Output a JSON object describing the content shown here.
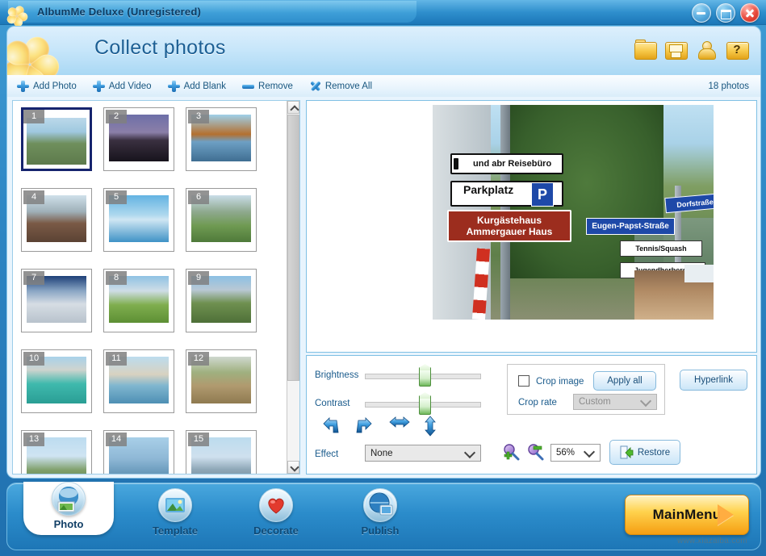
{
  "window": {
    "title": "AlbumMe Deluxe (Unregistered)",
    "app_icon": "flower-logo-icon",
    "controls": [
      {
        "name": "minimize-button",
        "icon": "minimize-icon"
      },
      {
        "name": "maximize-button",
        "icon": "maximize-icon"
      },
      {
        "name": "close-button",
        "icon": "close-icon"
      }
    ]
  },
  "header": {
    "logo_icon": "flower-logo-icon",
    "page_title": "Collect photos",
    "icons": [
      {
        "name": "open-project-icon",
        "label": "Open"
      },
      {
        "name": "save-project-icon",
        "label": "Save"
      },
      {
        "name": "user-account-icon",
        "label": "Account"
      },
      {
        "name": "help-icon",
        "label": "Help",
        "glyph": "?"
      }
    ]
  },
  "toolbar": {
    "buttons": [
      {
        "label": "Add Photo",
        "icon": "add-plus-icon"
      },
      {
        "label": "Add Video",
        "icon": "add-plus-icon"
      },
      {
        "label": "Add Blank",
        "icon": "add-plus-icon"
      },
      {
        "label": "Remove",
        "icon": "minus-bar-icon"
      },
      {
        "label": "Remove All",
        "icon": "cross-x-icon"
      }
    ],
    "photo_count": "18 photos"
  },
  "thumbnails": {
    "selected_index": 1,
    "items": [
      {
        "num": "1",
        "alt": "street direction signs"
      },
      {
        "num": "2",
        "alt": "matterhorn at dusk"
      },
      {
        "num": "3",
        "alt": "autumn lake reflection"
      },
      {
        "num": "4",
        "alt": "alpine village street"
      },
      {
        "num": "5",
        "alt": "matterhorn lake reflection"
      },
      {
        "num": "6",
        "alt": "green valley cliffs"
      },
      {
        "num": "7",
        "alt": "snow glacier"
      },
      {
        "num": "8",
        "alt": "meadow and snowy peaks"
      },
      {
        "num": "9",
        "alt": "red train in valley"
      },
      {
        "num": "10",
        "alt": "castle on turquoise lake"
      },
      {
        "num": "11",
        "alt": "chillon castle lake"
      },
      {
        "num": "12",
        "alt": "bench under tree"
      },
      {
        "num": "13",
        "alt": "lakeside trees"
      },
      {
        "num": "14",
        "alt": "boat on lake"
      },
      {
        "num": "15",
        "alt": "church spire by lake"
      }
    ],
    "scrollbar": {
      "up_arrow_icon": "chevron-up-icon",
      "down_arrow_icon": "chevron-down-icon"
    }
  },
  "preview": {
    "photo_alt": "German street direction signs",
    "signs": [
      "und abr Reisebüro",
      "Parkplatz",
      "Kurgästehaus",
      "Ammergauer Haus",
      "Eugen-Papst-Straße",
      "Dorfstraße",
      "Tennis/Squash",
      "Jugendherberge"
    ]
  },
  "edit": {
    "brightness_label": "Brightness",
    "contrast_label": "Contrast",
    "brightness_value": 50,
    "contrast_value": 50,
    "rotate_icons": [
      {
        "name": "rotate-left-icon"
      },
      {
        "name": "rotate-right-icon"
      },
      {
        "name": "flip-horizontal-icon"
      },
      {
        "name": "flip-vertical-icon"
      }
    ],
    "effect_label": "Effect",
    "effect_value": "None",
    "zoom_in_icon": "zoom-in-icon",
    "zoom_out_icon": "zoom-out-icon",
    "zoom_value": "56%",
    "restore_label": "Restore",
    "crop_checkbox_label": "Crop image",
    "crop_checked": false,
    "apply_all_label": "Apply all",
    "crop_rate_label": "Crop rate",
    "crop_rate_value": "Custom",
    "hyperlink_label": "Hyperlink"
  },
  "nav": {
    "tabs": [
      {
        "label": "Photo",
        "icon": "photo-icon",
        "active": true
      },
      {
        "label": "Template",
        "icon": "template-icon",
        "active": false
      },
      {
        "label": "Decorate",
        "icon": "heart-icon",
        "active": false
      },
      {
        "label": "Publish",
        "icon": "globe-icon",
        "active": false
      }
    ],
    "main_menu_label": "MainMenu",
    "main_menu_arrow_icon": "arrow-right-icon"
  },
  "watermark": {
    "text": "www.xiazaiba.com"
  },
  "colors": {
    "accent_blue": "#2b8ccb",
    "title_blue": "#1c5f94",
    "panel_bg": "#e8f4fd",
    "selection_border": "#16246e",
    "mainmenu_orange": "#ffd24d",
    "close_red": "#e8483a"
  }
}
